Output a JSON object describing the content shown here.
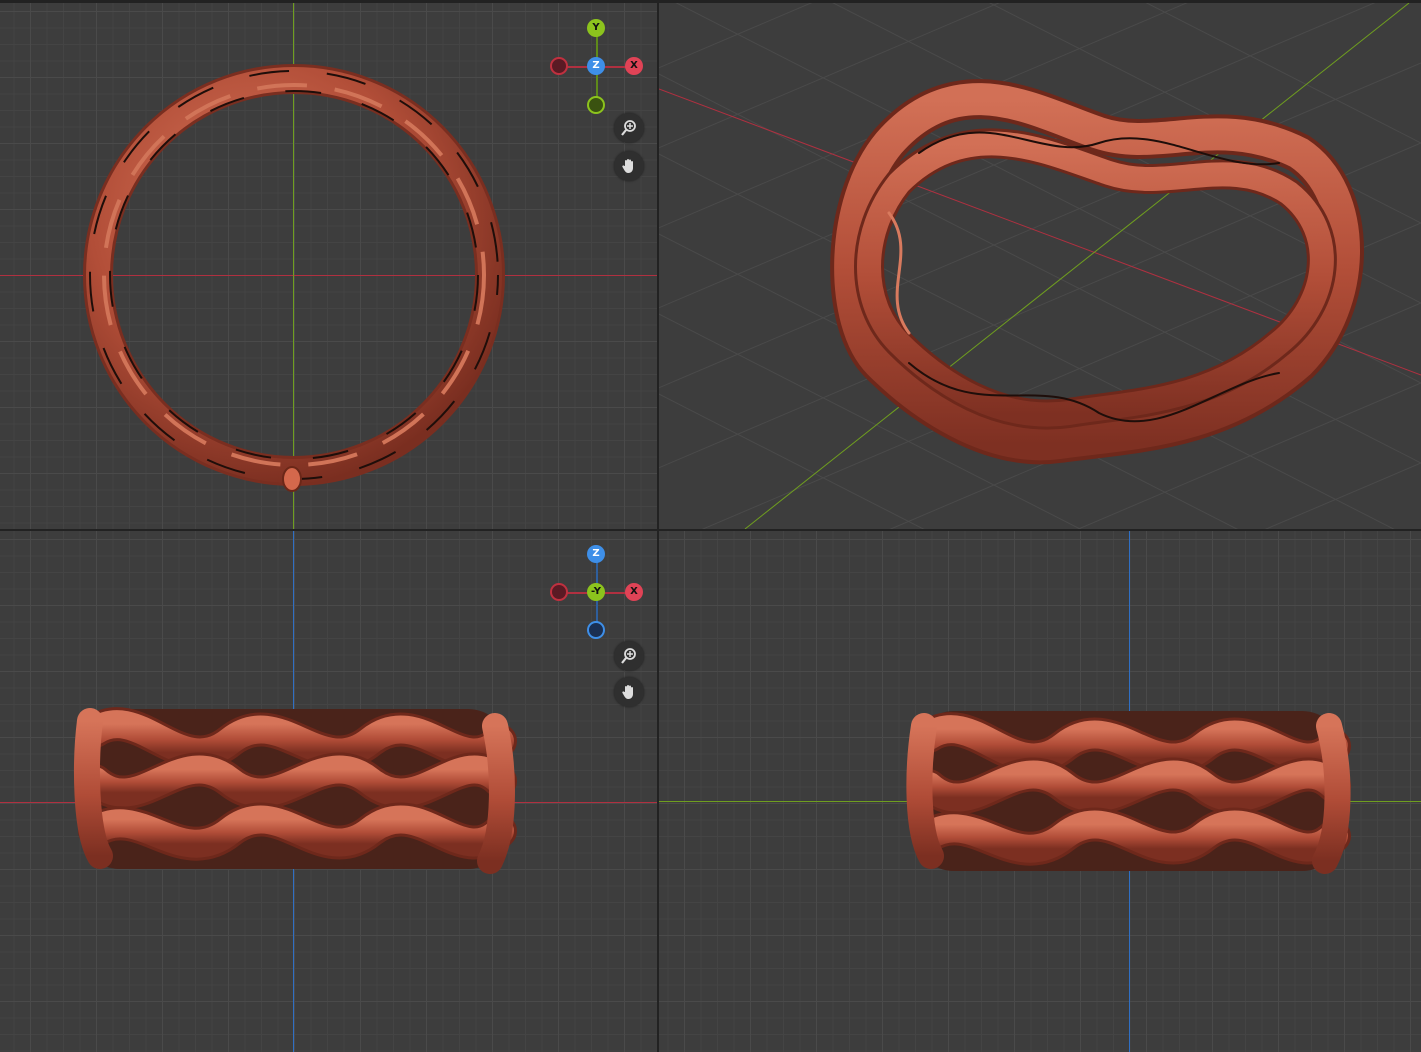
{
  "viewports": {
    "top": {
      "gizmo": {
        "positive_axis": "Y",
        "center_axis": "Z",
        "right_axis": "X"
      },
      "tools": {
        "zoom_icon": "zoom-in-icon",
        "pan_icon": "hand-icon"
      }
    },
    "front": {
      "gizmo": {
        "positive_axis": "Z",
        "center_axis": "-Y",
        "right_axis": "X"
      },
      "tools": {
        "zoom_icon": "zoom-in-icon",
        "pan_icon": "hand-icon"
      }
    }
  },
  "colors": {
    "background": "#3d3d3d",
    "grid": "#4a4a4a",
    "x_axis": "#c0303f",
    "y_axis": "#6f9e1f",
    "z_axis": "#2f6fc4",
    "mesh": "#b9533d",
    "gizmo_x": "#e04356",
    "gizmo_y": "#8cc31d",
    "gizmo_z": "#3e8fe8"
  }
}
